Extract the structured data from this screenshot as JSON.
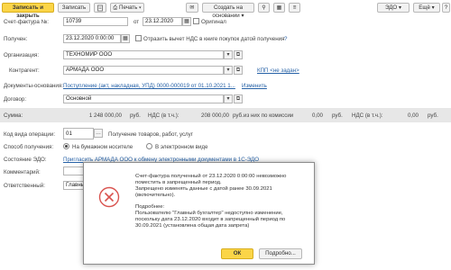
{
  "toolbar": {
    "save_close": "Записать и закрыть",
    "save": "Записать",
    "print": "Печать",
    "create_based": "Создать на основании",
    "edo": "ЭДО",
    "more": "Ещё"
  },
  "form": {
    "invoice_label": "Счет-фактура №:",
    "invoice_number": "10739",
    "from_label": "от",
    "invoice_date": "23.12.2020",
    "original_label": "Оригинал",
    "received_label": "Получен:",
    "received_date": "23.12.2020  0:00:00",
    "reflect_vat_label": "Отразить вычет НДС в книге покупок датой получения",
    "org_label": "Организация:",
    "org_value": "ТЕХНОМИР ООО",
    "counterparty_label": "Контрагент:",
    "counterparty_value": "АРМАДА ООО",
    "kpp_link": "КПП <не задан>",
    "basis_label": "Документы-основания:",
    "basis_link": "Поступление (акт, накладная, УПД) 0000-000019 от 01.10.2021 1...",
    "change_link": "Изменить",
    "contract_label": "Договор:",
    "contract_value": "Основной",
    "sum_label": "Сумма:",
    "sum_value": "1 248 000,00",
    "sum_currency": "руб.",
    "vat_label": "НДС (в т.ч.):",
    "vat_value": "208 000,00",
    "commission_label": "из них по комиссии",
    "commission_value": "0,00",
    "commission_currency": "руб.",
    "commission_vat_label": "НДС (в т.ч.):",
    "commission_vat_value": "0,00",
    "op_code_label": "Код вида операции:",
    "op_code_value": "01",
    "op_code_desc": "Получение товаров, работ, услуг",
    "method_label": "Способ получения:",
    "method_paper": "На бумажном носителе",
    "method_electronic": "В электронном виде",
    "edo_state_label": "Состояние ЭДО:",
    "edo_state_link": "Пригласить АРМАДА ООО к обмену электронными документами в 1С-ЭДО",
    "comment_label": "Комментарий:",
    "responsible_label": "Ответственный:",
    "responsible_value": "Главный"
  },
  "dialog": {
    "line1": "Счет-фактура полученный  от 23.12.2020 0:00:00 невозможно",
    "line2": "поместить в запрещенный период.",
    "line3": "Запрещено изменять данные с датой ранее 30.09.2021",
    "line4": "(включительно).",
    "line5": "Подробнее:",
    "line6": "Пользователю \"Главный бухгалтер\" недоступно изменение,",
    "line7": "поскольку дата 23.12.2020 входит в запрещенный период по",
    "line8": "30.09.2021 (установлена общая дата запрета)",
    "ok": "ОК",
    "details": "Подробно..."
  },
  "colors": {
    "primary_button": "#fbd547",
    "link": "#2762a7",
    "error_icon": "#d9534f"
  }
}
